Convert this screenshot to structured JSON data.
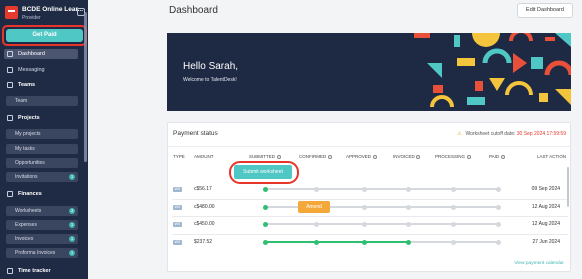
{
  "sidebar": {
    "brand_name": "BCDE Online Lear...",
    "brand_role": "Provider",
    "get_paid": "Get Paid",
    "dashboard": "Dashboard",
    "messaging": "Messaging",
    "teams_section": "Teams",
    "team": "Team",
    "projects_section": "Projects",
    "my_projects": "My projects",
    "my_tasks": "My tasks",
    "opportunities": "Opportunities",
    "invitations": "Invitations",
    "invitations_count": "1",
    "finances_section": "Finances",
    "worksheets": "Worksheets",
    "worksheets_count": "3",
    "expenses": "Expenses",
    "expenses_count": "1",
    "invoices": "Invoices",
    "invoices_count": "1",
    "proforma_invoices": "Proforma Invoices",
    "proforma_count": "1",
    "time_tracker": "Time tracker"
  },
  "header": {
    "title": "Dashboard",
    "edit_label": "Edit Dashboard"
  },
  "banner": {
    "greeting": "Hello Sarah,",
    "welcome": "Welcome to TalentDesk!"
  },
  "payment_status": {
    "title": "Payment status",
    "cutoff_label": "Worksheet cutoff date:",
    "cutoff_date": "30 Sep 2024 17:59:59",
    "columns": [
      "TYPE",
      "AMOUNT",
      "SUBMITTED",
      "CONFIRMED",
      "APPROVED",
      "INVOICED",
      "PROCESSING",
      "PAID",
      "LAST ACTION"
    ],
    "submit_label": "Submit worksheet",
    "amend_label": "Amend",
    "rows": [
      {
        "type": "WS",
        "amount": "c$56.17",
        "date": "09 Sep 2024",
        "progress": 1
      },
      {
        "type": "WS",
        "amount": "c$480.00",
        "date": "12 Aug 2024",
        "progress": 1
      },
      {
        "type": "WS",
        "amount": "c$450.00",
        "date": "12 Aug 2024",
        "progress": 1
      },
      {
        "type": "WS",
        "amount": "$237.52",
        "date": "27 Jun 2024",
        "progress": 4
      }
    ],
    "footer_link": "View payment calendar"
  },
  "colors": {
    "sidebar_bg": "#1f2b44",
    "accent_teal": "#4fc7c4",
    "accent_green": "#2fbf71",
    "highlight_red": "#e6362b",
    "amend_orange": "#f5a83a"
  }
}
